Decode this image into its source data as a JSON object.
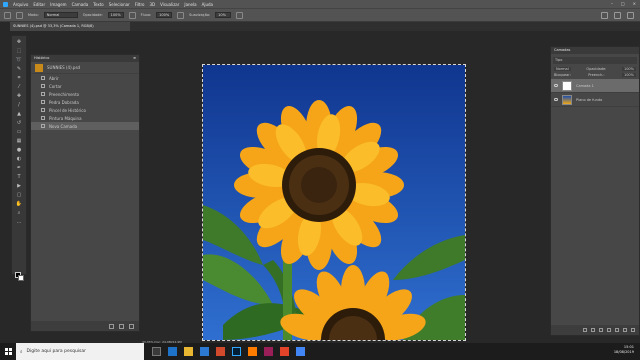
{
  "menubar": {
    "items": [
      "Arquivo",
      "Editar",
      "Imagem",
      "Camada",
      "Texto",
      "Selecionar",
      "Filtro",
      "3D",
      "Visualizar",
      "Janela",
      "Ajuda"
    ]
  },
  "options": {
    "mode_label": "Modo:",
    "mode_value": "Normal",
    "opacity_label": "Opacidade:",
    "opacity_value": "100%",
    "flow_label": "Fluxo:",
    "flow_value": "100%",
    "smoothing_label": "Suavização:",
    "smoothing_value": "10%"
  },
  "document": {
    "tab_title": "SUNNIES (4).psd @ 33,3% (Camada 1, RGB/8)"
  },
  "history": {
    "title": "Histórico",
    "snapshot": "SUNNIES (4).psd",
    "states": [
      "Abrir",
      "Cortar",
      "Preenchimento",
      "Pedra Dobrada",
      "Pincel de Histórico",
      "Pintura Máquina",
      "Nova Camada"
    ]
  },
  "layers": {
    "title": "Camadas",
    "filter": "Tipo",
    "blend": "Normal",
    "opacity_label": "Opacidade:",
    "opacity": "100%",
    "lock_label": "Bloquear:",
    "fill_label": "Preench.:",
    "fill": "100%",
    "items": [
      {
        "name": "Camada 1",
        "selected": true
      },
      {
        "name": "Plano de fundo",
        "selected": false
      }
    ]
  },
  "status": {
    "text": "33,33%   Doc: 24,9M/24,9M"
  },
  "taskbar": {
    "search_placeholder": "Digite aqui para pesquisar",
    "time": "15:01",
    "date": "18/08/2019"
  },
  "colors": {
    "sky": "#1f52b5",
    "petal": "#f5a517",
    "center": "#3a2410",
    "leaf": "#3e7a2a"
  }
}
